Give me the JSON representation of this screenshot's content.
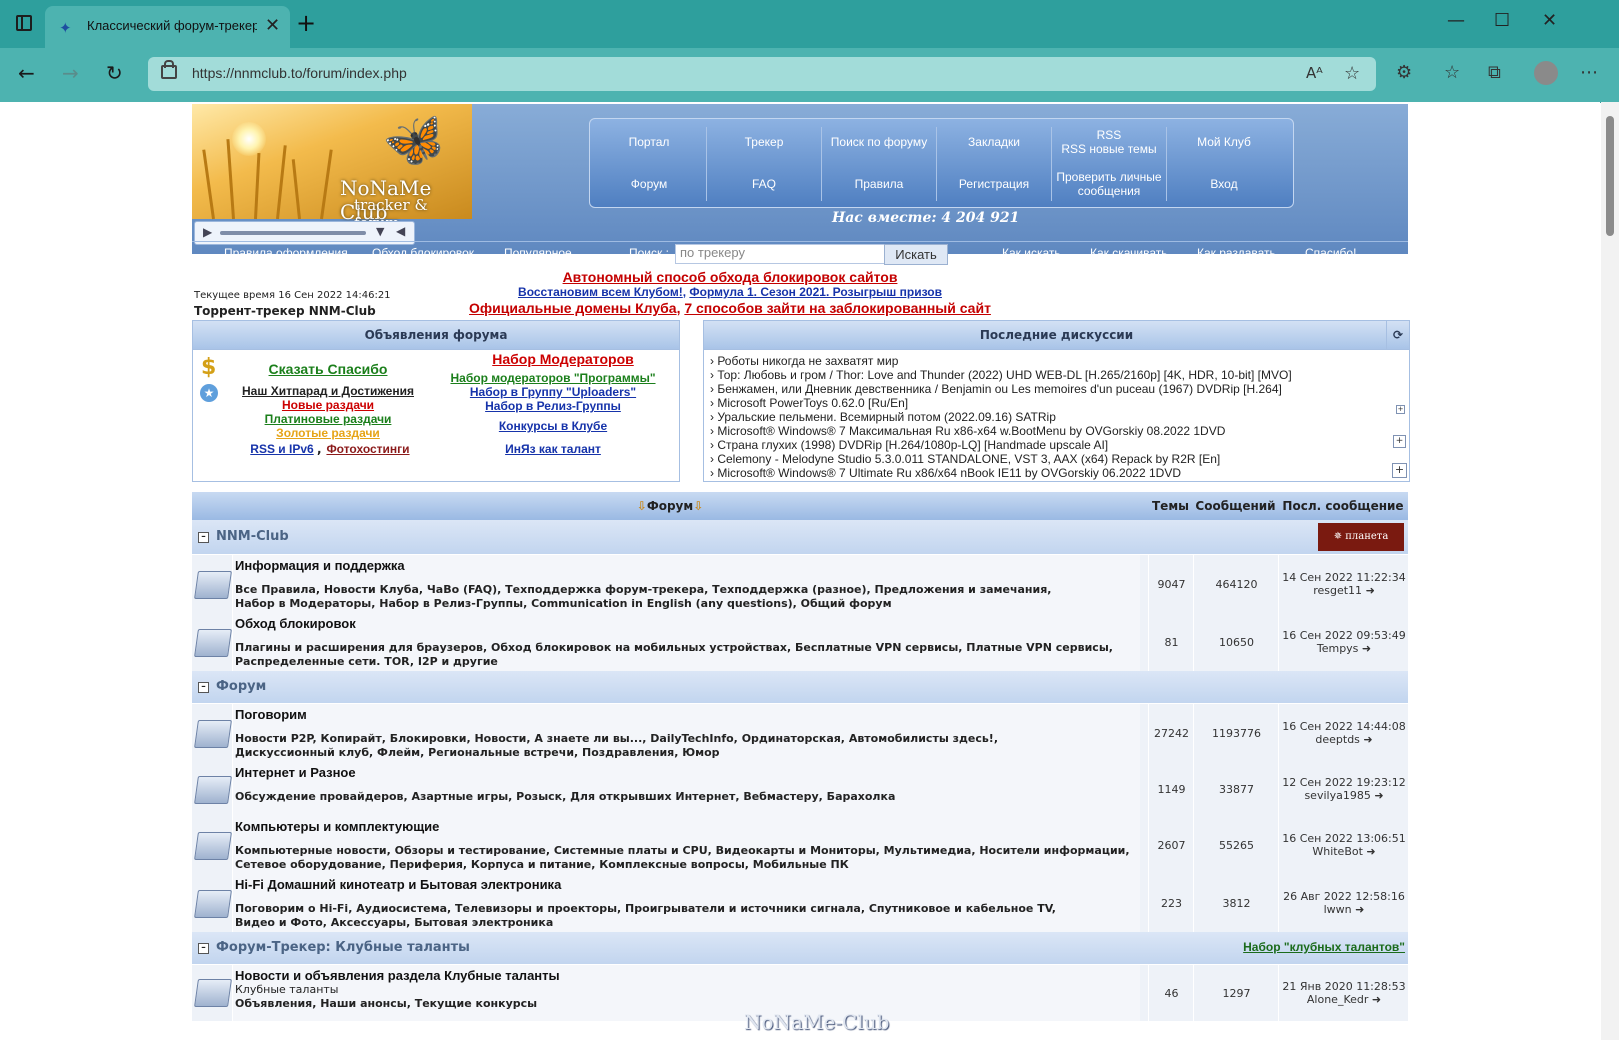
{
  "browser": {
    "tab_title": "Классический форум-трекер ::",
    "url": "https://nnmclub.to/forum/index.php"
  },
  "header": {
    "logo_title": "NoNaMe Club",
    "logo_sub": "tracker & forum",
    "nav_row1": [
      "Портал",
      "Трекер",
      "Поиск по форуму",
      "Закладки",
      "RSS\nRSS новые темы",
      "Мой Клуб"
    ],
    "nav_row2": [
      "Форум",
      "FAQ",
      "Правила",
      "Регистрация",
      "Проверить личные\nсообщения",
      "Вход"
    ],
    "together": "Нас вместе: 4 204 921",
    "subnav": [
      "Правила оформления",
      "Обход блокировок",
      "Популярное"
    ],
    "search_label": "Поиск :",
    "search_placeholder": "по трекеру",
    "search_button": "Искать",
    "subnav_right": [
      "Как искать",
      "Как скачивать",
      "Как раздавать",
      "Спасибо!"
    ]
  },
  "info": {
    "time": "Текущее время 16 Сен 2022 14:46:21",
    "tracker_name": "Торрент-трекер NNM-Club",
    "ann1": "Автономный способ обхода блокировок сайтов",
    "ann2a": "Восстановим всем Клубом!",
    "ann2b": "Формула 1. Сезон 2021. Розыгрыш призов",
    "ann3a": "Официальные домены Клуба",
    "ann3b": "7 способов зайти на заблокированный сайт"
  },
  "announcements": {
    "title": "Объявления форума",
    "say_thanks": "Сказать Спасибо",
    "hit_parade": "Наш Хитпарад и Достижения",
    "new_releases": "Новые раздачи",
    "platinum": "Платиновые раздачи",
    "gold": "Золотые раздачи",
    "rss": "RSS и IPv6",
    "photo": "Фотохостинги",
    "mod_recruit": "Набор Модераторов",
    "mod_programs": "Набор модераторов \"Программы\"",
    "uploaders": "Набор в Группу \"Uploaders\"",
    "release_group": "Набор в Релиз-Группы",
    "contests": "Конкурсы в Клубе",
    "inyaz": "ИнЯз как талант"
  },
  "discussions": {
    "title": "Последние дискуссии",
    "items": [
      "› Роботы никогда не захватят мир",
      "› Тор: Любовь и гром / Thor: Love and Thunder (2022) UHD WEB-DL [H.265/2160p] [4K, HDR, 10-bit] [MVO]",
      "› Бенжамен, или Дневник девственника / Benjamin ou Les memoires d'un puceau (1967) DVDRip [H.264]",
      "› Microsoft PowerToys 0.62.0 [Ru/En]",
      "› Уральские пельмени. Всемирный потом (2022.09.16) SATRip",
      "› Microsoft® Windows® 7 Максимальная Ru x86-x64 w.BootMenu by OVGorskiy 08.2022 1DVD",
      "› Страна глухих (1998) DVDRip [H.264/1080p-LQ] [Handmade upscale AI]",
      "› Celemony - Melodyne Studio 5.3.0.011 STANDALONE, VST 3, AAX (x64) Repack by R2R [En]",
      "› Microsoft® Windows® 7 Ultimate Ru x86/x64 nBook IE11 by OVGorskiy 06.2022 1DVD"
    ]
  },
  "forum": {
    "head_forum": "Форум",
    "head_topics": "Темы",
    "head_posts": "Сообщений",
    "head_last": "Посл. сообщение",
    "cat1": "NNM-Club",
    "cat2": "Форум",
    "cat3": "Форум-Трекер: Клубные таланты",
    "cat3_link": "Набор \"клубных талантов\"",
    "rows": [
      {
        "title": "Информация и поддержка",
        "subs1": "Все Правила,  Новости Клуба,  ЧаВо (FAQ),  Техподдержка форум-трекера,  Техподдержка (разное),  Предложения и замечания,",
        "subs2": "Набор в Модераторы,  Набор в Релиз-Группы,  Communication in English (any questions),  Общий форум",
        "topics": "9047",
        "posts": "464120",
        "last_date": "14 Сен 2022 11:22:34",
        "last_user": "resget11"
      },
      {
        "title": "Обход блокировок",
        "subs1": "Плагины и расширения для браузеров,  Обход блокировок на мобильных устройствах,  Бесплатные VPN сервисы,  Платные VPN сервисы,",
        "subs2": "Распределенные сети. TOR, I2P и другие",
        "topics": "81",
        "posts": "10650",
        "last_date": "16 Сен 2022 09:53:49",
        "last_user": "Tempys"
      },
      {
        "title": "Поговорим",
        "subs1": "Новости P2P, Копирайт, Блокировки,  Новости,  А знаете ли вы...,  DailyTechInfo,  Ординаторская,  Автомобилисты здесь!,",
        "subs2": "Дискуссионный клуб,  Флейм,  Региональные встречи,  Поздравления,  Юмор",
        "topics": "27242",
        "posts": "1193776",
        "last_date": "16 Сен 2022 14:44:08",
        "last_user": "deeptds"
      },
      {
        "title": "Интернет и Разное",
        "subs1": "Обсуждение провайдеров,  Азартные игры,  Розыск,  Для открывших Интернет,  Вебмастеру,  Барахолка",
        "subs2": "",
        "topics": "1149",
        "posts": "33877",
        "last_date": "12 Сен 2022 19:23:12",
        "last_user": "sevilya1985"
      },
      {
        "title": "Компьютеры и комплектующие",
        "subs1": "Компьютерные новости,  Обзоры и тестирование,  Системные платы и CPU,  Видеокарты и Мониторы,  Мультимедиа,  Носители информации,",
        "subs2": "Сетевое оборудование,  Периферия,  Корпуса и питание,  Комплексные вопросы,  Мобильные ПК",
        "topics": "2607",
        "posts": "55265",
        "last_date": "16 Сен 2022 13:06:51",
        "last_user": "WhiteBot"
      },
      {
        "title": "Hi-Fi Домашний кинотеатр и Бытовая электроника",
        "subs1": "Поговорим о Hi-Fi,  Аудиосистема,  Телевизоры и проекторы,  Проигрыватели и источники сигнала,  Спутниковое и кабельное TV,",
        "subs2": "Видео и Фото,  Аксессуары,  Бытовая электроника",
        "topics": "223",
        "posts": "3812",
        "last_date": "26 Авг 2022 12:58:16",
        "last_user": "lwwn"
      },
      {
        "title": "Новости и объявления раздела Клубные таланты",
        "desc": "Клубные таланты",
        "subs1": "Объявления,  Наши анонсы,  Текущие конкурсы",
        "subs2": "",
        "topics": "46",
        "posts": "1297",
        "last_date": "21 Янв 2020 11:28:53",
        "last_user": "Alone_Kedr"
      }
    ],
    "footer_logo": "NoNaMe-Club"
  }
}
